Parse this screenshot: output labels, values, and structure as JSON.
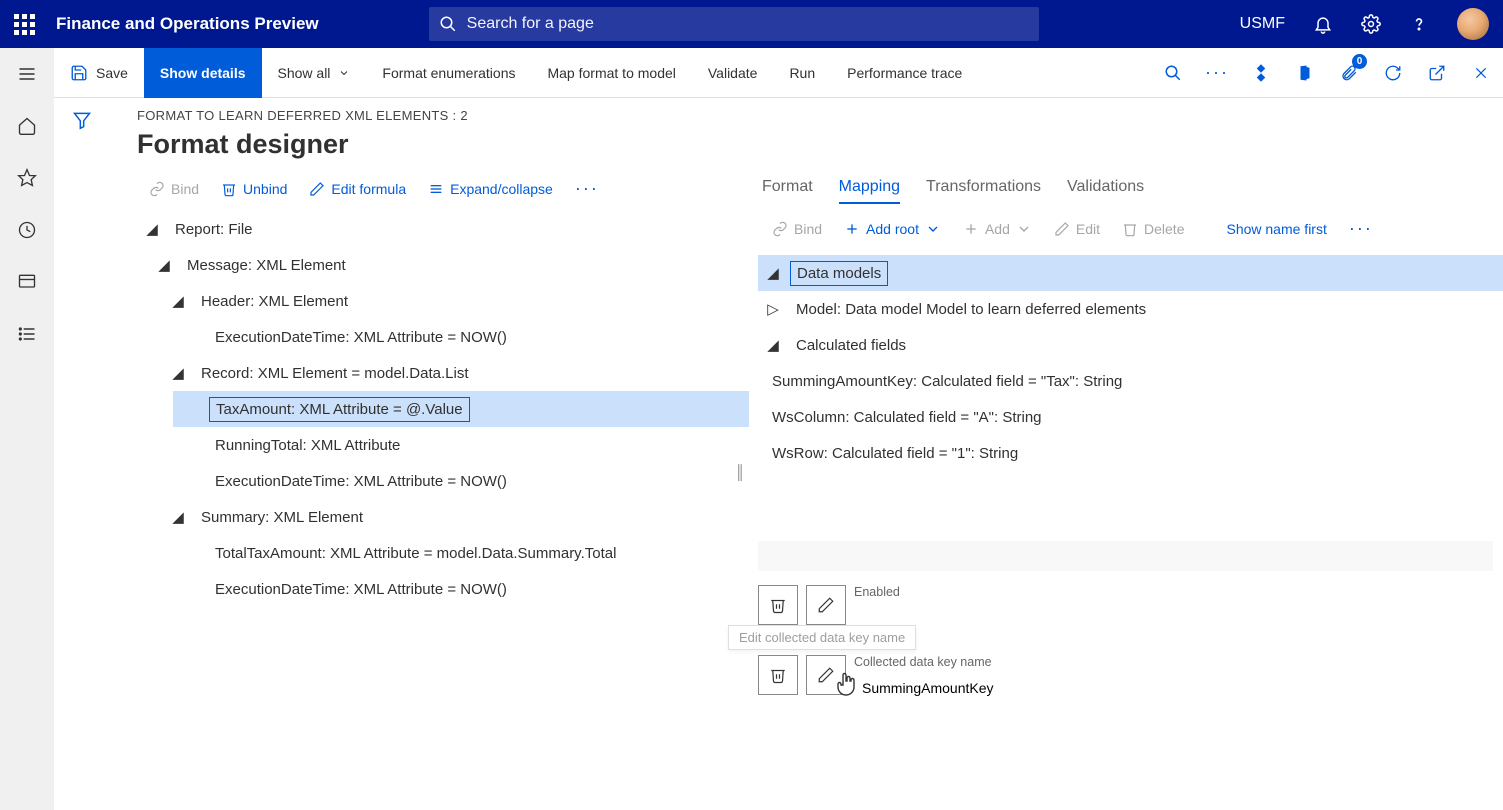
{
  "header": {
    "app_title": "Finance and Operations Preview",
    "search_placeholder": "Search for a page",
    "company": "USMF"
  },
  "command_bar": {
    "save": "Save",
    "show_details": "Show details",
    "show_all": "Show all",
    "format_enumerations": "Format enumerations",
    "map_format_to_model": "Map format to model",
    "validate": "Validate",
    "run": "Run",
    "performance_trace": "Performance trace",
    "attach_badge": "0"
  },
  "page": {
    "breadcrumb": "FORMAT TO LEARN DEFERRED XML ELEMENTS : 2",
    "title": "Format designer"
  },
  "left_toolbar": {
    "bind": "Bind",
    "unbind": "Unbind",
    "edit_formula": "Edit formula",
    "expand_collapse": "Expand/collapse"
  },
  "format_tree": {
    "root": "Report: File",
    "message": "Message: XML Element",
    "header": "Header: XML Element",
    "header_exec": "ExecutionDateTime: XML Attribute = NOW()",
    "record": "Record: XML Element = model.Data.List",
    "tax_amount": "TaxAmount: XML Attribute = @.Value",
    "running_total": "RunningTotal: XML Attribute",
    "record_exec": "ExecutionDateTime: XML Attribute = NOW()",
    "summary": "Summary: XML Element",
    "total_tax": "TotalTaxAmount: XML Attribute = model.Data.Summary.Total",
    "summary_exec": "ExecutionDateTime: XML Attribute = NOW()"
  },
  "right": {
    "tabs": {
      "format": "Format",
      "mapping": "Mapping",
      "transformations": "Transformations",
      "validations": "Validations"
    },
    "toolbar": {
      "bind": "Bind",
      "add_root": "Add root",
      "add": "Add",
      "edit": "Edit",
      "delete": "Delete",
      "show_name_first": "Show name first"
    },
    "tree": {
      "data_models": "Data models",
      "model": "Model: Data model Model to learn deferred elements",
      "calculated_fields": "Calculated fields",
      "summing_key": "SummingAmountKey: Calculated field = \"Tax\": String",
      "ws_column": "WsColumn: Calculated field = \"A\": String",
      "ws_row": "WsRow: Calculated field = \"1\": String"
    },
    "props": {
      "enabled_label": "Enabled",
      "enabled_value": "",
      "key_name_label": "Collected data key name",
      "key_name_value": "SummingAmountKey",
      "tooltip": "Edit collected data key name"
    }
  }
}
